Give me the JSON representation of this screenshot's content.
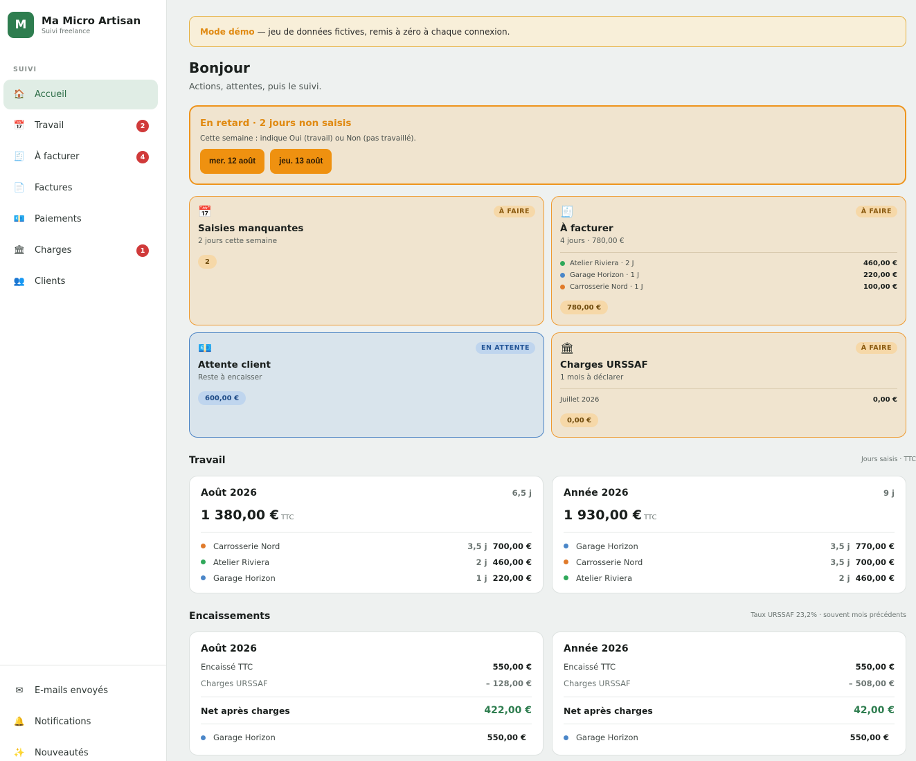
{
  "brand": {
    "logo_letter": "M",
    "name": "Ma Micro Artisan",
    "subtitle": "Suivi freelance"
  },
  "sidebar": {
    "section_label": "SUIVI",
    "items": [
      {
        "label": "Accueil",
        "icon": "house-icon",
        "glyph": "🏠",
        "active": true
      },
      {
        "label": "Travail",
        "icon": "calendar-icon",
        "glyph": "📅",
        "badge": "2"
      },
      {
        "label": "À facturer",
        "icon": "receipt-icon",
        "glyph": "🧾",
        "badge": "4"
      },
      {
        "label": "Factures",
        "icon": "document-icon",
        "glyph": "📄"
      },
      {
        "label": "Paiements",
        "icon": "banknote-icon",
        "glyph": "💶"
      },
      {
        "label": "Charges",
        "icon": "bank-icon",
        "glyph": "🏛",
        "badge": "1"
      },
      {
        "label": "Clients",
        "icon": "users-icon",
        "glyph": "👥"
      }
    ],
    "bottom_items": [
      {
        "label": "E-mails envoyés",
        "icon": "envelope-icon",
        "glyph": "✉"
      },
      {
        "label": "Notifications",
        "icon": "bell-icon",
        "glyph": "🔔"
      },
      {
        "label": "Nouveautés",
        "icon": "sparkles-icon",
        "glyph": "✨"
      }
    ]
  },
  "demo_banner": {
    "strong": "Mode démo",
    "text": "— jeu de données fictives, remis à zéro à chaque connexion."
  },
  "greeting": {
    "title": "Bonjour",
    "subtitle": "Actions, attentes, puis le suivi."
  },
  "late": {
    "title": "En retard · 2 jours non saisis",
    "description": "Cette semaine : indique Oui (travail) ou Non (pas travaillé).",
    "days": [
      "mer. 12 août",
      "jeu. 13 août"
    ]
  },
  "cards": {
    "missing": {
      "icon": "calendar-icon",
      "glyph": "📅",
      "tag": "À FAIRE",
      "title": "Saisies manquantes",
      "subtitle": "2 jours cette semaine",
      "pill": "2"
    },
    "to_invoice": {
      "icon": "receipt-icon",
      "glyph": "🧾",
      "tag": "À FAIRE",
      "title": "À facturer",
      "subtitle": "4 jours · 780,00 €",
      "rows": [
        {
          "label": "Atelier Riviera · 2 J",
          "amount": "460,00 €",
          "color": "#2fa85a"
        },
        {
          "label": "Garage Horizon · 1 J",
          "amount": "220,00 €",
          "color": "#4a86c8"
        },
        {
          "label": "Carrosserie Nord · 1 J",
          "amount": "100,00 €",
          "color": "#e07a2a"
        }
      ],
      "pill": "780,00 €"
    },
    "waiting": {
      "icon": "banknote-icon",
      "glyph": "💶",
      "tag": "EN ATTENTE",
      "title": "Attente client",
      "subtitle": "Reste à encaisser",
      "pill": "600,00 €"
    },
    "urssaf": {
      "icon": "bank-icon",
      "glyph": "🏛",
      "tag": "À FAIRE",
      "title": "Charges URSSAF",
      "subtitle": "1 mois à déclarer",
      "row": {
        "label": "Juillet 2026",
        "amount": "0,00 €"
      },
      "pill": "0,00 €"
    }
  },
  "travail": {
    "title": "Travail",
    "note": "Jours saisis · TTC",
    "panels": [
      {
        "title": "Août 2026",
        "days": "6,5 j",
        "total": "1 380,00 €",
        "ttc": "TTC",
        "rows": [
          {
            "label": "Carrosserie Nord",
            "days": "3,5 j",
            "amount": "700,00 €",
            "color": "#e07a2a"
          },
          {
            "label": "Atelier Riviera",
            "days": "2 j",
            "amount": "460,00 €",
            "color": "#2fa85a"
          },
          {
            "label": "Garage Horizon",
            "days": "1 j",
            "amount": "220,00 €",
            "color": "#4a86c8"
          }
        ]
      },
      {
        "title": "Année 2026",
        "days": "9 j",
        "total": "1 930,00 €",
        "ttc": "TTC",
        "rows": [
          {
            "label": "Garage Horizon",
            "days": "3,5 j",
            "amount": "770,00 €",
            "color": "#4a86c8"
          },
          {
            "label": "Carrosserie Nord",
            "days": "3,5 j",
            "amount": "700,00 €",
            "color": "#e07a2a"
          },
          {
            "label": "Atelier Riviera",
            "days": "2 j",
            "amount": "460,00 €",
            "color": "#2fa85a"
          }
        ]
      }
    ]
  },
  "encaissements": {
    "title": "Encaissements",
    "note": "Taux URSSAF 23,2% · souvent mois précédents",
    "panels": [
      {
        "title": "Août 2026",
        "collected_label": "Encaissé TTC",
        "collected": "550,00 €",
        "charges_label": "Charges URSSAF",
        "charges": "– 128,00 €",
        "net_label": "Net après charges",
        "net": "422,00 €",
        "client": {
          "label": "Garage Horizon",
          "amount": "550,00 €",
          "color": "#4a86c8"
        }
      },
      {
        "title": "Année 2026",
        "collected_label": "Encaissé TTC",
        "collected": "550,00 €",
        "charges_label": "Charges URSSAF",
        "charges": "– 508,00 €",
        "net_label": "Net après charges",
        "net": "42,00 €",
        "client": {
          "label": "Garage Horizon",
          "amount": "550,00 €",
          "color": "#4a86c8"
        }
      }
    ]
  }
}
